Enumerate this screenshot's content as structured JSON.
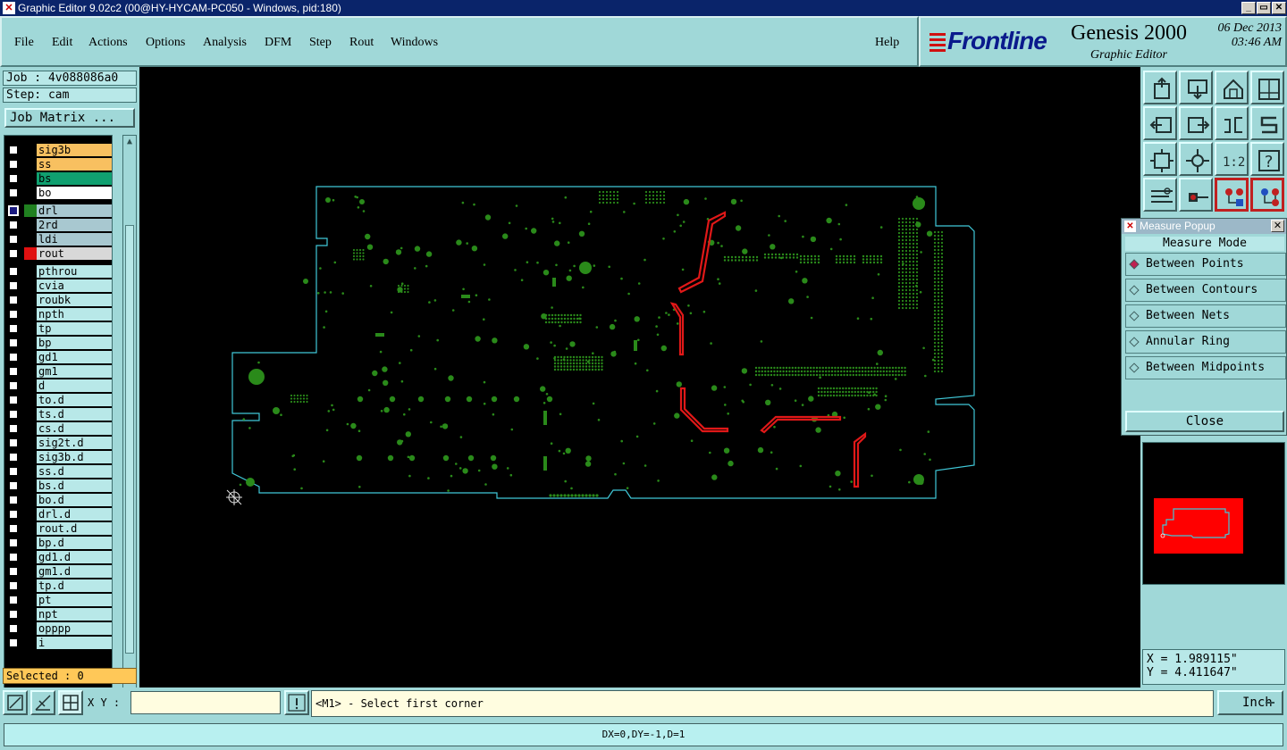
{
  "window": {
    "title": "Graphic Editor 9.02c2 (00@HY-HYCAM-PC050 - Windows, pid:180)",
    "controls": [
      "_",
      "▭",
      "✕"
    ]
  },
  "menu": {
    "items": [
      {
        "label": "File"
      },
      {
        "label": "Edit"
      },
      {
        "label": "Actions"
      },
      {
        "label": "Options"
      },
      {
        "label": "Analysis"
      },
      {
        "label": "DFM"
      },
      {
        "label": "Step"
      },
      {
        "label": "Rout"
      },
      {
        "label": "Windows"
      }
    ],
    "help": "Help"
  },
  "brand": {
    "logo": "Frontline",
    "product": "Genesis 2000",
    "subtitle": "Graphic Editor",
    "date": "06 Dec 2013",
    "time": "03:46 AM"
  },
  "job": {
    "job_label": "Job : 4v088086a0",
    "step_label": "Step: cam",
    "matrix_button": "Job Matrix ...",
    "selected": "Selected : 0"
  },
  "layers": [
    {
      "name": "sig3b",
      "bg": "#f8c060",
      "flag": "⬋",
      "checked": false,
      "swatch": ""
    },
    {
      "name": "ss",
      "bg": "#f8c060",
      "flag": "⬋",
      "checked": false,
      "swatch": ""
    },
    {
      "name": "bs",
      "bg": "#10a070",
      "flag": "⬋",
      "checked": false,
      "swatch": ""
    },
    {
      "name": "bo",
      "bg": "#ffffff",
      "flag": "⬋",
      "checked": false,
      "swatch": ""
    },
    {
      "name": "drl",
      "bg": "#a8c8d0",
      "flag": "⊞",
      "checked": true,
      "swatch": "#208020"
    },
    {
      "name": "2rd",
      "bg": "#a8c8d0",
      "flag": "",
      "checked": false,
      "swatch": ""
    },
    {
      "name": "ldi",
      "bg": "#a8c8d0",
      "flag": "",
      "checked": false,
      "swatch": ""
    },
    {
      "name": "rout",
      "bg": "#d8d8d8",
      "flag": "",
      "checked": false,
      "swatch": "#e01010"
    },
    {
      "name": "pthrou",
      "bg": "#b8e8e8",
      "flag": "",
      "checked": false,
      "swatch": ""
    },
    {
      "name": "cvia",
      "bg": "#b8e8e8",
      "flag": "",
      "checked": false,
      "swatch": ""
    },
    {
      "name": "roubk",
      "bg": "#b8e8e8",
      "flag": "",
      "checked": false,
      "swatch": ""
    },
    {
      "name": "npth",
      "bg": "#b8e8e8",
      "flag": "",
      "checked": false,
      "swatch": ""
    },
    {
      "name": "tp",
      "bg": "#b8e8e8",
      "flag": "",
      "checked": false,
      "swatch": ""
    },
    {
      "name": "bp",
      "bg": "#b8e8e8",
      "flag": "",
      "checked": false,
      "swatch": ""
    },
    {
      "name": "gd1",
      "bg": "#b8e8e8",
      "flag": "⬋",
      "checked": false,
      "swatch": ""
    },
    {
      "name": "gm1",
      "bg": "#b8e8e8",
      "flag": "⬋",
      "checked": false,
      "swatch": ""
    },
    {
      "name": "d",
      "bg": "#b8e8e8",
      "flag": "",
      "checked": false,
      "swatch": ""
    },
    {
      "name": "to.d",
      "bg": "#b8e8e8",
      "flag": "⬋",
      "checked": false,
      "swatch": ""
    },
    {
      "name": "ts.d",
      "bg": "#b8e8e8",
      "flag": "⬋",
      "checked": false,
      "swatch": ""
    },
    {
      "name": "cs.d",
      "bg": "#b8e8e8",
      "flag": "⬋",
      "checked": false,
      "swatch": ""
    },
    {
      "name": "sig2t.d",
      "bg": "#b8e8e8",
      "flag": "⬋",
      "checked": false,
      "swatch": ""
    },
    {
      "name": "sig3b.d",
      "bg": "#b8e8e8",
      "flag": "⬋",
      "checked": false,
      "swatch": ""
    },
    {
      "name": "ss.d",
      "bg": "#b8e8e8",
      "flag": "⬋",
      "checked": false,
      "swatch": ""
    },
    {
      "name": "bs.d",
      "bg": "#b8e8e8",
      "flag": "⬋",
      "checked": false,
      "swatch": ""
    },
    {
      "name": "bo.d",
      "bg": "#b8e8e8",
      "flag": "⬋",
      "checked": false,
      "swatch": ""
    },
    {
      "name": "drl.d",
      "bg": "#b8e8e8",
      "flag": "",
      "checked": false,
      "swatch": ""
    },
    {
      "name": "rout.d",
      "bg": "#b8e8e8",
      "flag": "",
      "checked": false,
      "swatch": ""
    },
    {
      "name": "bp.d",
      "bg": "#b8e8e8",
      "flag": "",
      "checked": false,
      "swatch": ""
    },
    {
      "name": "gd1.d",
      "bg": "#b8e8e8",
      "flag": "⬋",
      "checked": false,
      "swatch": ""
    },
    {
      "name": "gm1.d",
      "bg": "#b8e8e8",
      "flag": "⬋",
      "checked": false,
      "swatch": ""
    },
    {
      "name": "tp.d",
      "bg": "#b8e8e8",
      "flag": "",
      "checked": false,
      "swatch": ""
    },
    {
      "name": "pt",
      "bg": "#b8e8e8",
      "flag": "",
      "checked": false,
      "swatch": ""
    },
    {
      "name": "npt",
      "bg": "#b8e8e8",
      "flag": "",
      "checked": false,
      "swatch": ""
    },
    {
      "name": "opppp",
      "bg": "#b8e8e8",
      "flag": "",
      "checked": false,
      "swatch": ""
    },
    {
      "name": "i",
      "bg": "#b8e8e8",
      "flag": "",
      "checked": false,
      "swatch": ""
    }
  ],
  "colors": {
    "board_outline": "#40c8d8",
    "pads": "#2a8a1a",
    "rout": "#e01818",
    "panel_bg": "#a0d8d8"
  },
  "tools": [
    {
      "icon": "step-up-icon"
    },
    {
      "icon": "step-down-icon"
    },
    {
      "icon": "home-icon"
    },
    {
      "icon": "window-icon"
    },
    {
      "icon": "pan-left-icon"
    },
    {
      "icon": "pan-right-icon"
    },
    {
      "icon": "undo-view-icon"
    },
    {
      "icon": "redo-view-icon"
    },
    {
      "icon": "zoom-fit-icon"
    },
    {
      "icon": "zoom-profile-icon"
    },
    {
      "icon": "zoom-1to1-icon"
    },
    {
      "icon": "help-icon"
    },
    {
      "icon": "tools-icon"
    },
    {
      "icon": "probe-icon"
    },
    {
      "icon": "netlist-icon"
    },
    {
      "icon": "netlist2-icon"
    }
  ],
  "tool_labels": {
    "one_to_one": "1:2",
    "help": "?"
  },
  "measure": {
    "title": "Measure Popup",
    "mode_label": "Measure Mode",
    "options": [
      {
        "label": "Between Points",
        "selected": true
      },
      {
        "label": "Between Contours",
        "selected": false
      },
      {
        "label": "Between Nets",
        "selected": false
      },
      {
        "label": "Annular Ring",
        "selected": false
      },
      {
        "label": "Between Midpoints",
        "selected": false
      }
    ],
    "close": "Close"
  },
  "coords": {
    "x": "X = 1.989115\"",
    "y": "Y = 4.411647\""
  },
  "bottom": {
    "xy_label": "X Y :",
    "xy_value": "",
    "prompt": "<M1> - Select first corner",
    "unit": "Inch",
    "status": "DX=0,DY=-1,D=1"
  }
}
